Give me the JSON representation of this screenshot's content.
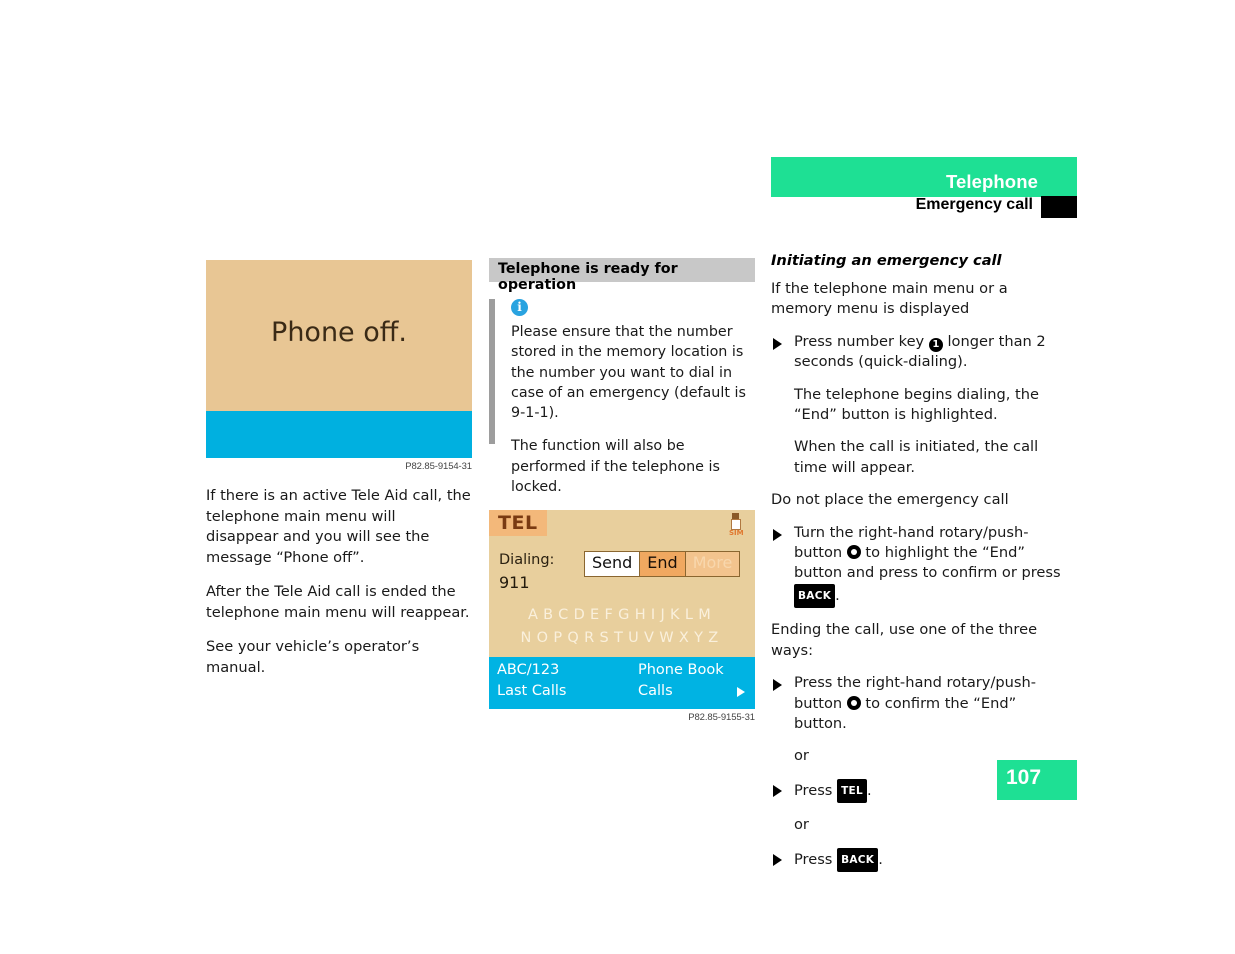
{
  "header": {
    "section_title": "Telephone",
    "topic_title": "Emergency call",
    "green_hex": "#1ee094"
  },
  "left_column": {
    "figure": {
      "screen_text": "Phone off.",
      "caption": "P82.85-9154-31",
      "bg_hex": "#e8c694",
      "bottom_bar_hex": "#00b0e0"
    },
    "paragraphs": [
      "If there is an active Tele Aid call, the telephone main menu will disappear and you will see the message “Phone off”.",
      "After the Tele Aid call is ended the telephone main menu will reappear.",
      "See your vehicle’s operator’s manual."
    ]
  },
  "middle_column": {
    "gray_heading": "Telephone is ready for operation",
    "note": {
      "icon": "info-icon",
      "paragraphs": [
        "Please ensure that the number stored in the memory location is the number you want to dial in case of an emergency (default is 9-1-1).",
        "The function will also be performed if the telephone is locked."
      ]
    },
    "tel_screen": {
      "badge": "TEL",
      "status_label": "SIM",
      "dialing_label": "Dialing:",
      "dialing_number": "911",
      "buttons": [
        "Send",
        "End",
        "More"
      ],
      "alphabet_row_1": "ABCDEFGHIJKLM",
      "alphabet_row_2": "NOPQRSTUVWXYZ",
      "bottom_left_1": "ABC/123",
      "bottom_left_2": "Last Calls",
      "bottom_right_1": "Phone Book",
      "bottom_right_2": "Calls",
      "caption": "P82.85-9155-31"
    }
  },
  "right_column": {
    "subheading": "Initiating an emergency call",
    "intro": "If the telephone main menu or a memory menu is displayed",
    "step1": {
      "prefix": "Press number key",
      "key": "1",
      "suffix": "longer than 2 seconds (quick-dialing)."
    },
    "result1": "The telephone begins dialing, the “End” button is highlighted.",
    "result2": "When the call is initiated, the call time will appear.",
    "no_call_heading": "Do not place the emergency call",
    "step2": {
      "part1": "Turn the right-hand rotary/push-button",
      "part2": "to highlight the “End” button and press to confirm or press",
      "key_back": "BACK",
      "period": "."
    },
    "ending_heading": "Ending the call, use one of the three ways:",
    "step3": {
      "part1": "Press the right-hand rotary/push-button",
      "part2": "to confirm the “End” button."
    },
    "or_label_1": "or",
    "step4": {
      "prefix": "Press",
      "key": "TEL",
      "period": "."
    },
    "or_label_2": "or",
    "step5": {
      "prefix": "Press",
      "key": "BACK",
      "period": "."
    }
  },
  "footer": {
    "page_number": "107"
  }
}
